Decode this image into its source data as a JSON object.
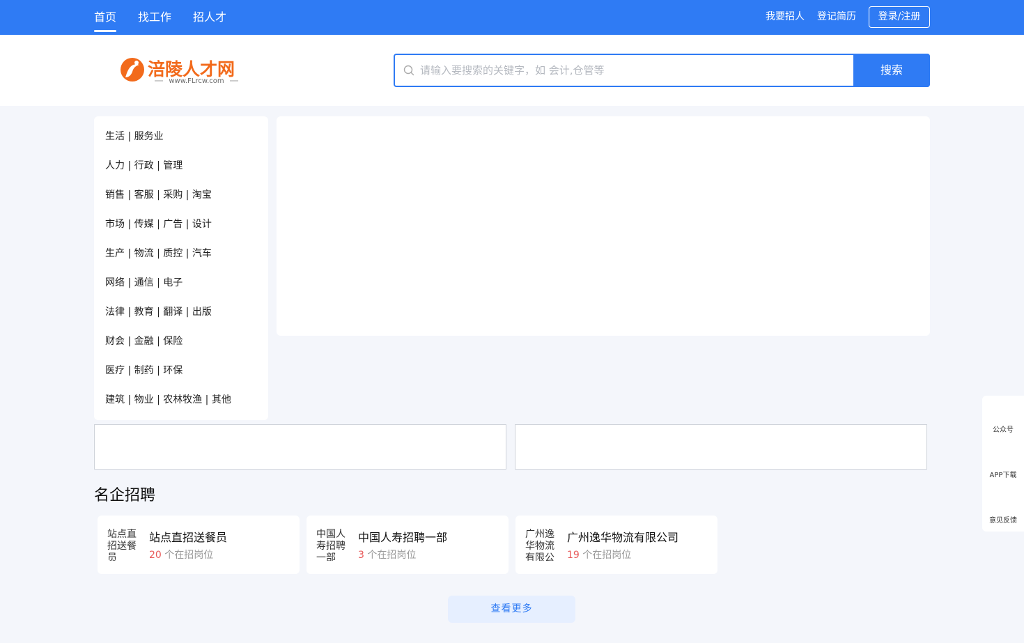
{
  "nav": {
    "items": [
      "首页",
      "找工作",
      "招人才"
    ],
    "active": "首页",
    "post_job": "我要招人",
    "register_resume": "登记简历",
    "login": "登录/注册"
  },
  "logo": {
    "name": "涪陵人才网",
    "url_text": "www.FLrcw.com"
  },
  "search": {
    "placeholder": "请输入要搜索的关键字，如 会计,仓管等",
    "value": "",
    "button": "搜索"
  },
  "categories": [
    "生活 | 服务业",
    "人力 | 行政 | 管理",
    "销售 | 客服 | 采购 | 淘宝",
    "市场 | 传媒 | 广告 | 设计",
    "生产 | 物流 | 质控 | 汽车",
    "网络 | 通信 | 电子",
    "法律 | 教育 | 翻译 | 出版",
    "财会 | 金融 | 保险",
    "医疗 | 制药 | 环保",
    "建筑 | 物业 | 农林牧渔 | 其他"
  ],
  "famous": {
    "title": "名企招聘",
    "companies": [
      {
        "name": "站点直招送餐员",
        "count": "20",
        "suffix": "个在招岗位",
        "logo_alt": "站点直招送餐员"
      },
      {
        "name": "中国人寿招聘一部",
        "count": "3",
        "suffix": "个在招岗位",
        "logo_alt": "中国人寿招聘一部"
      },
      {
        "name": "广州逸华物流有限公司",
        "count": "19",
        "suffix": "个在招岗位",
        "logo_alt": "广州逸华物流有限公司"
      }
    ],
    "more": "查看更多"
  },
  "sidebar": {
    "wechat": "公众号",
    "app": "APP下载",
    "feedback": "意见反馈"
  },
  "colors": {
    "primary": "#2f7bf4",
    "accent_red": "#e85a5a",
    "logo_orange": "#f26a1b"
  }
}
